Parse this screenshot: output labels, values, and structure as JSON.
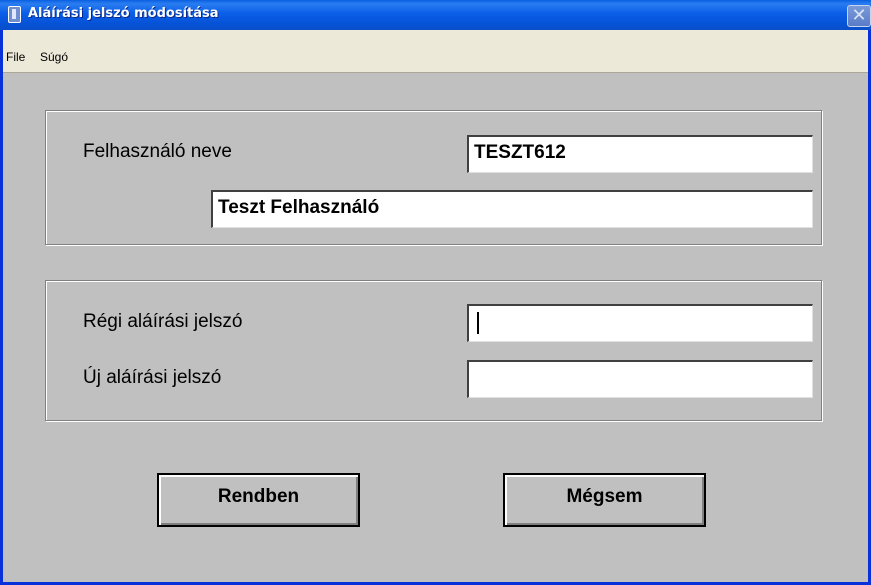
{
  "window": {
    "title": "Aláírási jelszó módosítása",
    "close_glyph": "✕"
  },
  "menu": {
    "items": [
      {
        "label": "File"
      },
      {
        "label": "Súgó"
      }
    ]
  },
  "user_group": {
    "username_label": "Felhasználó neve",
    "username_value": "TESZT612",
    "fullname_value": "Teszt Felhasználó"
  },
  "password_group": {
    "old_password_label": "Régi aláírási jelszó",
    "old_password_value": "",
    "new_password_label": "Új aláírási jelszó",
    "new_password_value": ""
  },
  "buttons": {
    "ok_label": "Rendben",
    "cancel_label": "Mégsem"
  },
  "colors": {
    "titlebar": "#0a5ee8",
    "dialog_background": "#c0c0c0",
    "menubar_background": "#ece9d8"
  }
}
